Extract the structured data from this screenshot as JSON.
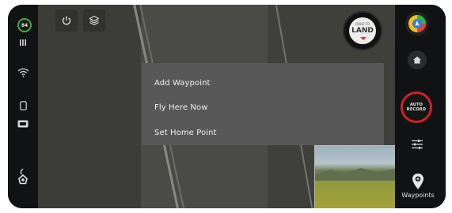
{
  "status": {
    "battery_percent": "84"
  },
  "land_button": {
    "hold_text": "HOLD TO",
    "label": "LAND"
  },
  "context_menu": {
    "items": [
      {
        "label": "Add Waypoint"
      },
      {
        "label": "Fly Here Now"
      },
      {
        "label": "Set Home Point"
      }
    ]
  },
  "auto_record": {
    "line1": "AUTO",
    "line2": "RECORD"
  },
  "waypoints": {
    "label": "Waypoints"
  },
  "colors": {
    "battery_ring": "#3fae3f",
    "land_arrow": "#e0382e",
    "auto_record_ring": "#c8242a",
    "context_menu_bg": "#585858"
  },
  "icons": {
    "left_rail": [
      "battery-ring-icon",
      "signal-bars-icon",
      "wifi-icon",
      "phone-icon",
      "4k-icon",
      "gimbal-icon"
    ],
    "toolbar": [
      "power-icon",
      "layers-icon"
    ],
    "right_rail": [
      "compass-icon",
      "home-icon",
      "sliders-icon",
      "waypoint-pin-icon"
    ]
  }
}
